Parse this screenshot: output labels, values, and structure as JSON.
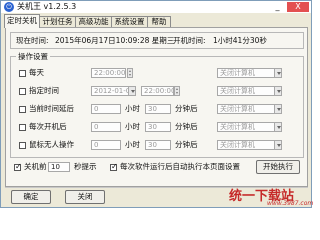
{
  "window": {
    "title": "关机王 v1.2.5.3",
    "minimize": "_",
    "close": "X"
  },
  "tabs": [
    {
      "label": "定时关机"
    },
    {
      "label": "计划任务"
    },
    {
      "label": "高级功能"
    },
    {
      "label": "系统设置"
    },
    {
      "label": "帮助"
    }
  ],
  "info": {
    "now_label": "现在时间:",
    "now_value": "2015年06月17日10:09:28 星期三",
    "uptime_label": "开机时间:",
    "uptime_value": "1小时41分30秒"
  },
  "ops": {
    "group_label": "操作设置",
    "rows": [
      {
        "label": "每天",
        "value": "22:00:00",
        "action": "关闭计算机"
      },
      {
        "label": "指定时间",
        "value": "2012-01-01",
        "value2": "22:00:00",
        "action": "关闭计算机"
      },
      {
        "label": "当前时间延后",
        "num": "0",
        "unit1": "小时",
        "num2": "30",
        "unit2": "分钟后",
        "action": "关闭计算机"
      },
      {
        "label": "每次开机后",
        "num": "0",
        "unit1": "小时",
        "num2": "30",
        "unit2": "分钟后",
        "action": "关闭计算机"
      },
      {
        "label": "鼠标无人操作",
        "num": "0",
        "unit1": "小时",
        "num2": "30",
        "unit2": "分钟后",
        "action": "关闭计算机"
      }
    ]
  },
  "bottom": {
    "prompt_prefix": "关机前",
    "prompt_value": "10",
    "prompt_suffix": "秒提示",
    "autorun_label": "每次软件运行后自动执行本页面设置",
    "start_button": "开始执行"
  },
  "footer": {
    "ok_button": "确定",
    "close_button": "关闭"
  },
  "watermark": {
    "brand": "统一下载站",
    "url": "www.3987.com"
  },
  "colors": {
    "accent": "#2a62d1",
    "close": "#e35050",
    "watermark": "#c62a2a"
  }
}
